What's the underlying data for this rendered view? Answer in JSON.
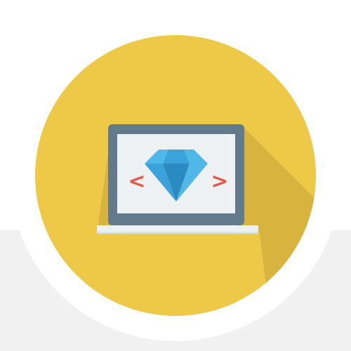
{
  "icon": {
    "name": "laptop-diamond-code-icon",
    "description_tags": [
      "laptop-icon",
      "diamond-icon",
      "code-brackets-icon"
    ],
    "colors": {
      "background_top": "#FFFFFF",
      "background_bottom": "#F1F1F1",
      "circle_ring": "#FFFFFF",
      "circle_fill": "#EEC847",
      "long_shadow": "#D8B43F",
      "laptop_frame": "#627A8C",
      "laptop_screen": "#EEF1F3",
      "laptop_base": "#EEF1F3",
      "laptop_base_shade": "#DCE1E5",
      "bracket": "#E35B4B",
      "diamond_light": "#4FB8E8",
      "diamond_mid": "#3AA4DA",
      "diamond_dark": "#2A8BC2"
    },
    "glyphs": {
      "left_bracket": "<",
      "right_bracket": ">"
    }
  }
}
